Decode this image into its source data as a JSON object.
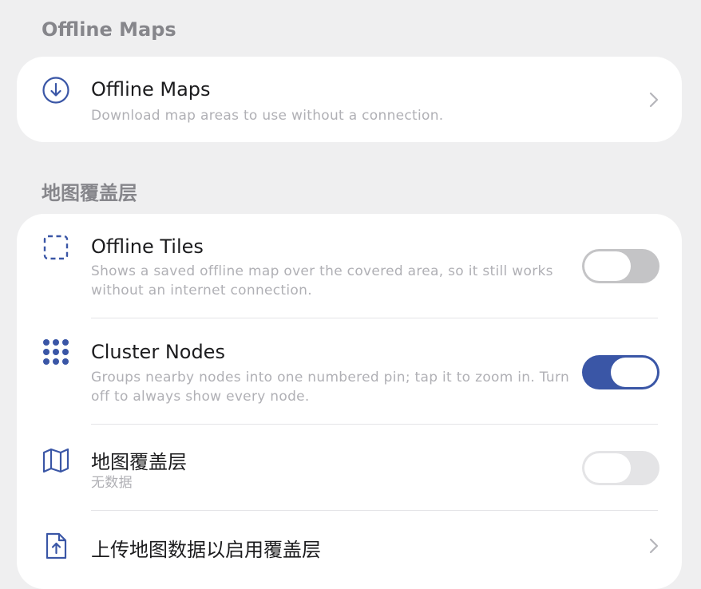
{
  "colors": {
    "accent": "#3a56a6",
    "background": "#efeff0",
    "card": "#ffffff",
    "subtitle": "#b0b0b5"
  },
  "offline_section": {
    "header": "Offline Maps",
    "items": [
      {
        "icon": "download-circle-icon",
        "title": "Offline Maps",
        "subtitle": "Download map areas to use without a connection."
      }
    ]
  },
  "overlay_section": {
    "header": "地图覆盖层",
    "items": [
      {
        "icon": "dashed-square-icon",
        "title": "Offline Tiles",
        "subtitle": "Shows a saved offline map over the covered area, so it still works without an internet connection.",
        "toggle_on": false
      },
      {
        "icon": "dot-grid-icon",
        "title": "Cluster Nodes",
        "subtitle": "Groups nearby nodes into one numbered pin; tap it to zoom in. Turn off to always show every node.",
        "toggle_on": true
      },
      {
        "icon": "map-icon",
        "title": "地图覆盖层",
        "subtitle": "无数据",
        "toggle_on": false,
        "toggle_disabled": true
      },
      {
        "icon": "upload-file-icon",
        "title": "上传地图数据以启用覆盖层"
      }
    ]
  }
}
